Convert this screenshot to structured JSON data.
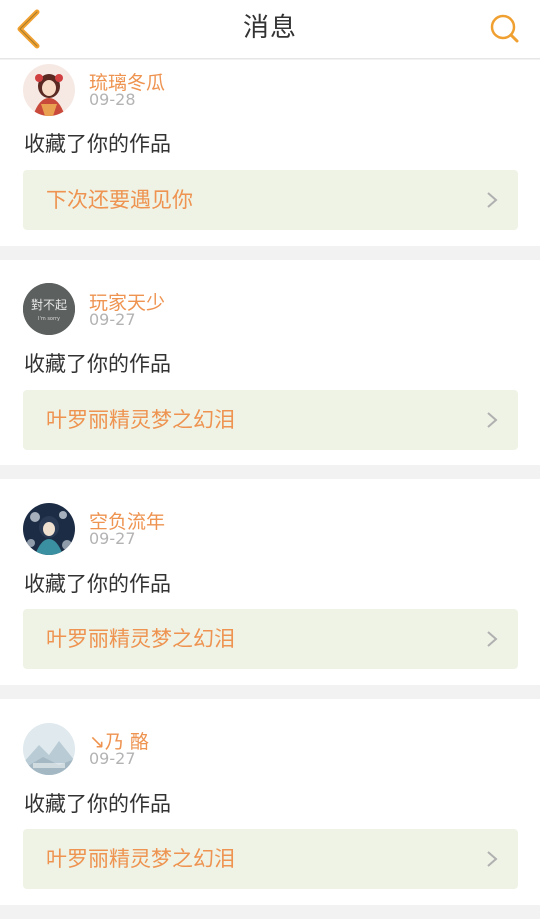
{
  "header": {
    "title": "消息",
    "back_icon": "chevron-left-icon",
    "search_icon": "search-icon",
    "accent_color": "#f0a030"
  },
  "messages": [
    {
      "username": "琉璃冬瓜",
      "date": "09-28",
      "action": "收藏了你的作品",
      "work_title": "下次还要遇见你",
      "avatar_icon": "anime-girl-avatar"
    },
    {
      "username": "玩家天少",
      "date": "09-27",
      "action": "收藏了你的作品",
      "work_title": "叶罗丽精灵梦之幻泪",
      "avatar_icon": "calligraphy-avatar",
      "avatar_text": "對不起",
      "avatar_subtext": "I'm sorry"
    },
    {
      "username": "空负流年",
      "date": "09-27",
      "action": "收藏了你的作品",
      "work_title": "叶罗丽精灵梦之幻泪",
      "avatar_icon": "anime-character-avatar"
    },
    {
      "username": "↘乃 酪",
      "date": "09-27",
      "action": "收藏了你的作品",
      "work_title": "叶罗丽精灵梦之幻泪",
      "avatar_icon": "landscape-avatar"
    }
  ],
  "colors": {
    "username": "#ee9350",
    "work_title": "#ee9350",
    "work_bg": "#eef3e6",
    "date": "#b3b3b3",
    "separator": "#f2f2f2"
  }
}
